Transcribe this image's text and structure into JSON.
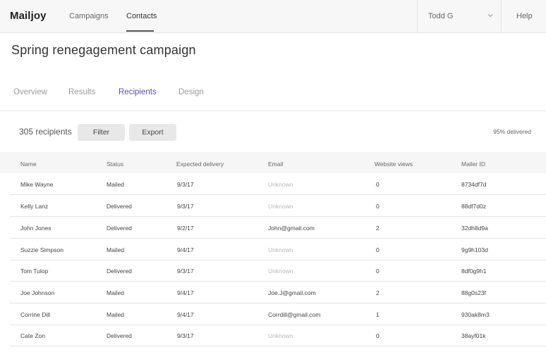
{
  "app": {
    "brand": "Mailjoy",
    "nav": [
      {
        "label": "Campaigns",
        "active": false
      },
      {
        "label": "Contacts",
        "active": true
      }
    ],
    "user": "Todd G",
    "help": "Help"
  },
  "campaign": {
    "title": "Spring renegagement campaign",
    "tabs": [
      {
        "label": "Overview",
        "active": false
      },
      {
        "label": "Results",
        "active": false
      },
      {
        "label": "Recipients",
        "active": true
      },
      {
        "label": "Design",
        "active": false
      }
    ]
  },
  "toolbar": {
    "count": "305 recipients",
    "filter": "Filter",
    "export": "Export",
    "delivered": "95% delivered"
  },
  "table": {
    "columns": [
      "Name",
      "Status",
      "Expected delivery",
      "Email",
      "Website views",
      "Mailer ID"
    ],
    "rows": [
      {
        "name": "Mike Wayne",
        "status": "Mailed",
        "delivery": "9/3/17",
        "email": "Unknown",
        "views": "0",
        "id": "8734df7d"
      },
      {
        "name": "Kelly Lanz",
        "status": "Delivered",
        "delivery": "9/3/17",
        "email": "Unknown",
        "views": "0",
        "id": "88df7d0z"
      },
      {
        "name": "John Jones",
        "status": "Delivered",
        "delivery": "9/2/17",
        "email": "John@gmail.com",
        "views": "2",
        "id": "32dh8d9a"
      },
      {
        "name": "Suzzie Simpson",
        "status": "Mailed",
        "delivery": "9/4/17",
        "email": "Unknown",
        "views": "0",
        "id": "9g9h103d"
      },
      {
        "name": "Tom Tulop",
        "status": "Delivered",
        "delivery": "9/3/17",
        "email": "Unknown",
        "views": "0",
        "id": "8df0g9h1"
      },
      {
        "name": "Joe Johnson",
        "status": "Mailed",
        "delivery": "9/4/17",
        "email": "Joe.J@gmail.com",
        "views": "2",
        "id": "88g0s23f"
      },
      {
        "name": "Corrine Dill",
        "status": "Mailed",
        "delivery": "9/4/17",
        "email": "Corrdill@gmail.com",
        "views": "1",
        "id": "930ak8m3"
      },
      {
        "name": "Cate Zon",
        "status": "Delivered",
        "delivery": "9/3/17",
        "email": "Unknown",
        "views": "0",
        "id": "38ayf01k"
      }
    ]
  },
  "colors": {
    "accent": "#5b4fa8",
    "muted": "#b7b7b7"
  }
}
